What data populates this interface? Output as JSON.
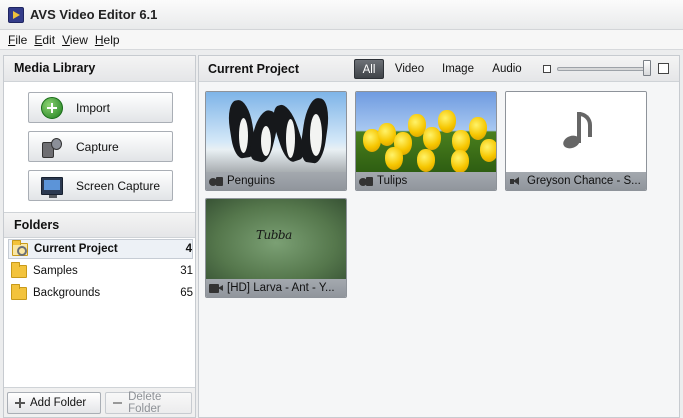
{
  "window": {
    "title": "AVS Video Editor 6.1"
  },
  "menu": [
    {
      "before": "",
      "underline": "F",
      "after": "ile",
      "name": "menu-file"
    },
    {
      "before": "",
      "underline": "E",
      "after": "dit",
      "name": "menu-edit"
    },
    {
      "before": "",
      "underline": "V",
      "after": "iew",
      "name": "menu-view"
    },
    {
      "before": "",
      "underline": "H",
      "after": "elp",
      "name": "menu-help"
    }
  ],
  "media_library": {
    "title": "Media Library",
    "buttons": {
      "import": "Import",
      "capture": "Capture",
      "screen_capture": "Screen Capture"
    }
  },
  "folders": {
    "title": "Folders",
    "items": [
      {
        "name": "Current Project",
        "count": "4"
      },
      {
        "name": "Samples",
        "count": "31"
      },
      {
        "name": "Backgrounds",
        "count": "65"
      }
    ],
    "add_folder": "Add Folder",
    "delete_folder": "Delete Folder"
  },
  "project": {
    "title": "Current Project",
    "filters": [
      "All",
      "Video",
      "Image",
      "Audio"
    ],
    "active_filter": "All",
    "zoom_level": 0.95,
    "items": [
      {
        "label": "Penguins",
        "type_icon": "image-icon"
      },
      {
        "label": "Tulips",
        "type_icon": "image-icon"
      },
      {
        "label": "Greyson Chance - S...",
        "type_icon": "audio-icon"
      },
      {
        "label": "[HD] Larva - Ant - Y...",
        "type_icon": "video-icon",
        "thumb_text": "Tubba"
      }
    ]
  },
  "colors": {
    "accent": "#3f4348",
    "label_bar": "#9ca1a7",
    "folder": "#f3c33c",
    "import_green": "#1d7d1d"
  }
}
